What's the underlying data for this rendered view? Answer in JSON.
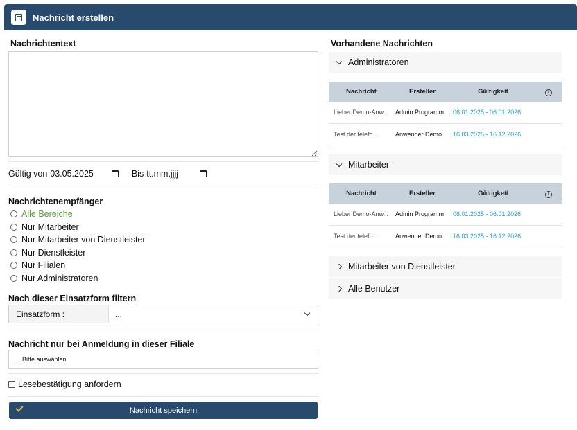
{
  "header": {
    "title": "Nachricht erstellen",
    "icon": "message-note-icon"
  },
  "form": {
    "message_text_label": "Nachrichtentext",
    "valid_from_label": "Gültig von",
    "valid_from_value": "03.05.2025",
    "valid_to_label": "Bis",
    "valid_to_value": "tt.mm.jjjj",
    "recipients_label": "Nachrichtenempfänger",
    "recipients": [
      {
        "label": "Alle Bereiche",
        "selected": true
      },
      {
        "label": "Nur Mitarbeiter",
        "selected": false
      },
      {
        "label": "Nur Mitarbeiter von Dienstleister",
        "selected": false
      },
      {
        "label": "Nur Dienstleister",
        "selected": false
      },
      {
        "label": "Nur Filialen",
        "selected": false
      },
      {
        "label": "Nur Administratoren",
        "selected": false
      }
    ],
    "filter_label": "Nach dieser Einsatzform filtern",
    "filter_select_label": "Einsatzform :",
    "filter_select_value": "...",
    "filiale_label": "Nachricht nur bei Anmeldung in dieser Filiale",
    "filiale_value": "... Bitte auswählen",
    "read_receipt_label": "Lesebestätigung anfordern",
    "save_label": "Nachricht speichern"
  },
  "existing": {
    "title": "Vorhandene Nachrichten",
    "columns": [
      "Nachricht",
      "Ersteller",
      "Gültigkeit"
    ],
    "groups": [
      {
        "label": "Administratoren",
        "expanded": true,
        "rows": [
          {
            "message": "Lieber Demo-Anw...",
            "creator": "Admin Programm",
            "validity": "06.01.2025 - 06.01.2026"
          },
          {
            "message": "Test der telefo...",
            "creator": "Anwender Demo",
            "validity": "16.03.2025 - 16.12.2026"
          }
        ]
      },
      {
        "label": "Mitarbeiter",
        "expanded": true,
        "rows": [
          {
            "message": "Lieber Demo-Anw...",
            "creator": "Admin Programm",
            "validity": "06.01.2025 - 06.01.2026"
          },
          {
            "message": "Test der telefo...",
            "creator": "Anwender Demo",
            "validity": "16.03.2025 - 16.12.2026"
          }
        ]
      },
      {
        "label": "Mitarbeiter von Dienstleister",
        "expanded": false,
        "rows": []
      },
      {
        "label": "Alle Benutzer",
        "expanded": false,
        "rows": []
      }
    ]
  },
  "colors": {
    "header": "#274a6d",
    "accent_green": "#5aa03a",
    "link_blue": "#2a9ed8",
    "table_header": "#c8d2dd"
  }
}
